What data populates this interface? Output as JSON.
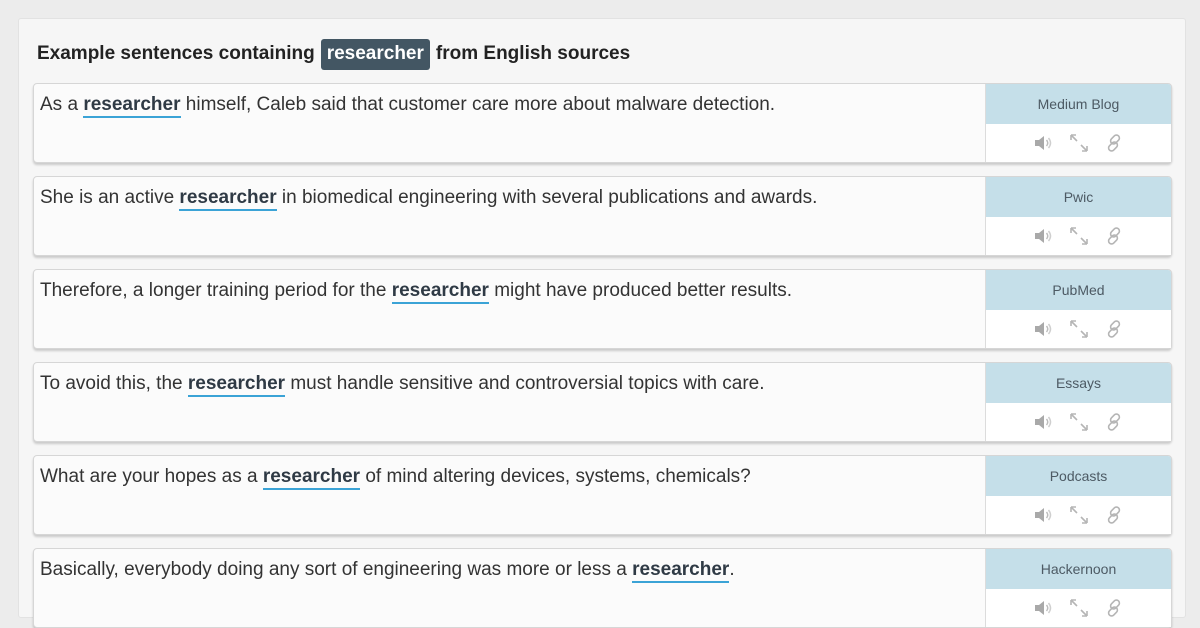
{
  "heading": {
    "prefix": "Example sentences containing",
    "keyword": "researcher",
    "suffix": "from English sources"
  },
  "icons": {
    "audio": "speaker-icon",
    "expand": "expand-icon",
    "link": "link-icon"
  },
  "examples": [
    {
      "before": "As a ",
      "keyword": "researcher",
      "after": " himself, Caleb said that customer care more about malware detection.",
      "source": "Medium Blog"
    },
    {
      "before": "She is an active ",
      "keyword": "researcher",
      "after": " in biomedical engineering with several publications and awards.",
      "source": "Pwic"
    },
    {
      "before": "Therefore, a longer training period for the ",
      "keyword": "researcher",
      "after": " might have produced better results.",
      "source": "PubMed"
    },
    {
      "before": "To avoid this, the ",
      "keyword": "researcher",
      "after": " must handle sensitive and controversial topics with care.",
      "source": "Essays"
    },
    {
      "before": "What are your hopes as a ",
      "keyword": "researcher",
      "after": " of mind altering devices, systems, chemicals?",
      "source": "Podcasts"
    },
    {
      "before": "Basically, everybody doing any sort of engineering was more or less a ",
      "keyword": "researcher",
      "after": ".",
      "source": "Hackernoon"
    }
  ],
  "colors": {
    "keyword_badge": "#435663",
    "underline": "#3ba3d6",
    "source_bg": "#c5dfe9"
  }
}
